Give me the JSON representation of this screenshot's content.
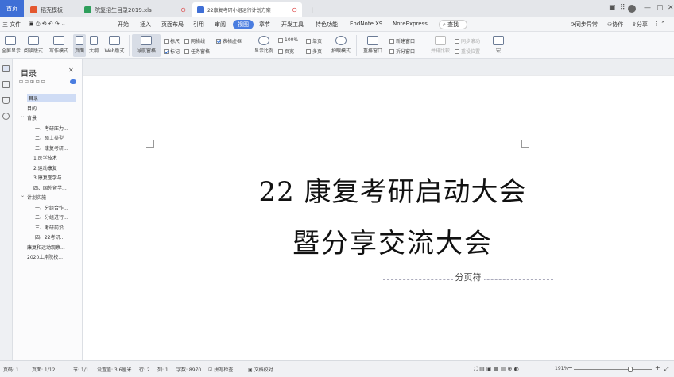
{
  "tabs": {
    "home": "首页",
    "t1": "稻壳模板",
    "t2": "院复招生目录2019.xls",
    "t3": "22康复考研小组运行计划方案",
    "new_tab": "+"
  },
  "menubar": {
    "file": "三 文件",
    "items": [
      "开始",
      "插入",
      "页面布局",
      "引用",
      "审阅",
      "视图",
      "章节",
      "开发工具",
      "特色功能",
      "EndNote X9",
      "NoteExpress"
    ],
    "active": "视图",
    "search": "查找",
    "sync": "同步异常",
    "collab": "协作",
    "share": "分享"
  },
  "ribbon": {
    "fullscreen": "全屏显示",
    "reading": "阅读版式",
    "writing": "写作模式",
    "page": "页面",
    "outline": "大纲",
    "web": "Web版式",
    "nav": "导航窗格",
    "ruler": "标尺",
    "gridlines": "网格线",
    "markup": "标记",
    "taskpane": "任务窗格",
    "tables_lines": "表格虚框",
    "display_ratio": "显示比例",
    "percent": "100%",
    "page_width": "页宽",
    "single_page": "单页",
    "multi_page": "多页",
    "eye_mode": "护眼模式",
    "rearrange": "重排窗口",
    "new_window": "新建窗口",
    "split_window": "拆分窗口",
    "sync_scroll": "同步滚动",
    "side_by_side": "并排比较",
    "reset_pos": "重设位置",
    "macro": "宏"
  },
  "toc": {
    "title": "目录",
    "items": [
      {
        "text": "目录",
        "level": 0,
        "selected": true
      },
      {
        "text": "目的",
        "level": 0
      },
      {
        "text": "背景",
        "level": 0,
        "expanded": true
      },
      {
        "text": "一、考研压力...",
        "level": 2
      },
      {
        "text": "二、硕士类型",
        "level": 2
      },
      {
        "text": "三、康复考研...",
        "level": 2
      },
      {
        "text": "1.医学技术",
        "level": 1
      },
      {
        "text": "2.运动康复",
        "level": 1
      },
      {
        "text": "3.康复医学与...",
        "level": 1
      },
      {
        "text": "四、国外留学...",
        "level": 1
      },
      {
        "text": "计划实施",
        "level": 0,
        "expanded": true
      },
      {
        "text": "一、分组合作...",
        "level": 2
      },
      {
        "text": "二、分组进行...",
        "level": 2
      },
      {
        "text": "三、考研前沿...",
        "level": 2
      },
      {
        "text": "四、22考研...",
        "level": 2
      },
      {
        "text": "康复和运动观察...",
        "level": 0
      },
      {
        "text": "2020上岸院校...",
        "level": 0
      }
    ]
  },
  "document": {
    "line1": "22 康复考研启动大会",
    "line2": "暨分享交流大会",
    "page_break": "分页符"
  },
  "status": {
    "page_num": "页码: 1",
    "page": "页面: 1/12",
    "section": "节: 1/1",
    "setting": "设置值: 3.6厘米",
    "row": "行: 2",
    "col": "列: 1",
    "words": "字数: 8970",
    "spell": "拼写检查",
    "proof": "文档校对",
    "zoom": "191%",
    "zoom_fraction": 0.72
  },
  "colors": {
    "accent": "#3f6fd6",
    "page": "#ffffff",
    "background": "#e9eaec"
  }
}
